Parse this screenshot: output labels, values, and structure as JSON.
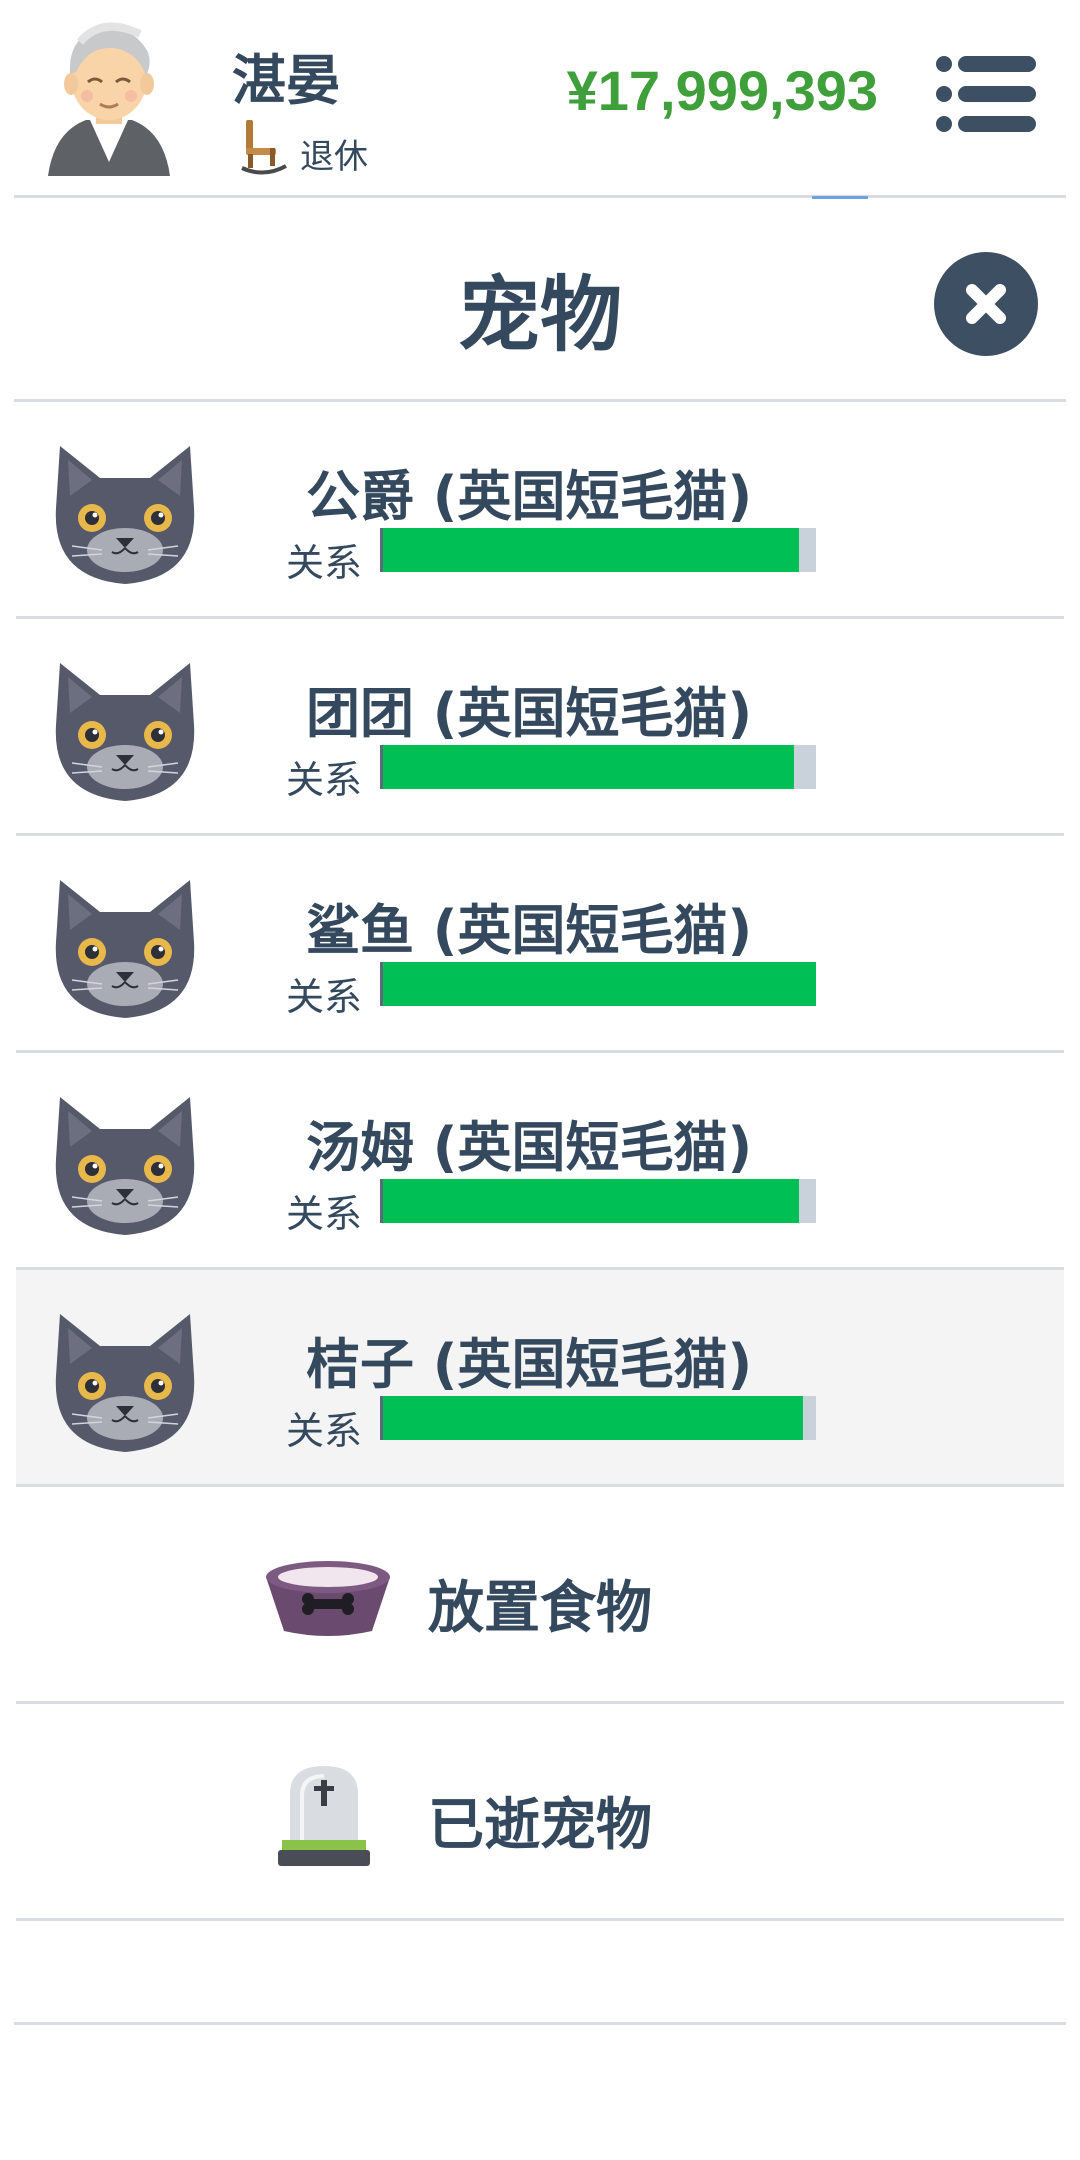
{
  "header": {
    "character_name": "湛晏",
    "status_label": "退休",
    "money": "¥17,999,393"
  },
  "page": {
    "title": "宠物"
  },
  "pets": [
    {
      "name": "公爵 (英国短毛猫)",
      "relation_label": "关系",
      "relationship": 0.96
    },
    {
      "name": "团团 (英国短毛猫)",
      "relation_label": "关系",
      "relationship": 0.95
    },
    {
      "name": "鲨鱼 (英国短毛猫)",
      "relation_label": "关系",
      "relationship": 1.0
    },
    {
      "name": "汤姆 (英国短毛猫)",
      "relation_label": "关系",
      "relationship": 0.96
    },
    {
      "name": "桔子 (英国短毛猫)",
      "relation_label": "关系",
      "relationship": 0.97
    }
  ],
  "actions": {
    "place_food": "放置食物",
    "deceased_pets": "已逝宠物"
  },
  "icons": {
    "avatar": "elderly-man-avatar",
    "status": "rocking-chair-icon",
    "menu": "menu-icon",
    "close": "close-icon",
    "pet": "cat-face-icon",
    "food": "pet-bowl-icon",
    "deceased": "tombstone-icon"
  },
  "colors": {
    "money": "#3f9f3a",
    "relationship_bar": "#00bf55",
    "bar_track": "#c9d2da",
    "text": "#34495e"
  }
}
